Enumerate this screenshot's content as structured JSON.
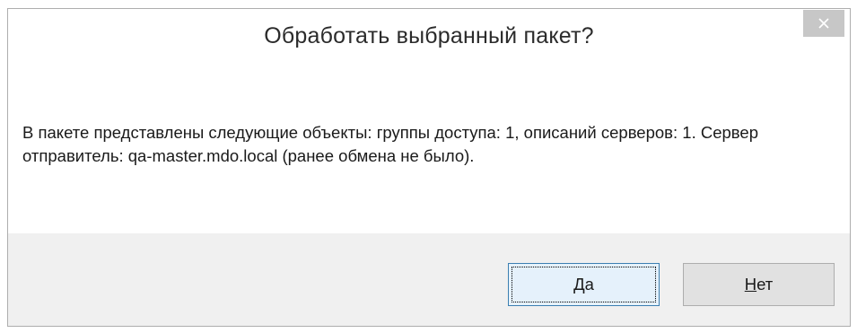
{
  "dialog": {
    "title": "Обработать выбранный пакет?",
    "message": "В пакете представлены следующие объекты: группы доступа: 1, описаний серверов: 1. Сервер отправитель: qa-master.mdo.local (ранее обмена не было).",
    "close_icon": "close-icon"
  },
  "buttons": {
    "yes": {
      "mnemonic": "Д",
      "rest": "а"
    },
    "no": {
      "mnemonic": "Н",
      "rest": "ет"
    }
  },
  "colors": {
    "close_button_bg": "#c7c7c7",
    "default_button_border": "#3c7fb1",
    "default_button_bg": "#e5f1fb",
    "button_bg": "#e1e1e1",
    "dialog_footer_bg": "#f0f0f0"
  }
}
